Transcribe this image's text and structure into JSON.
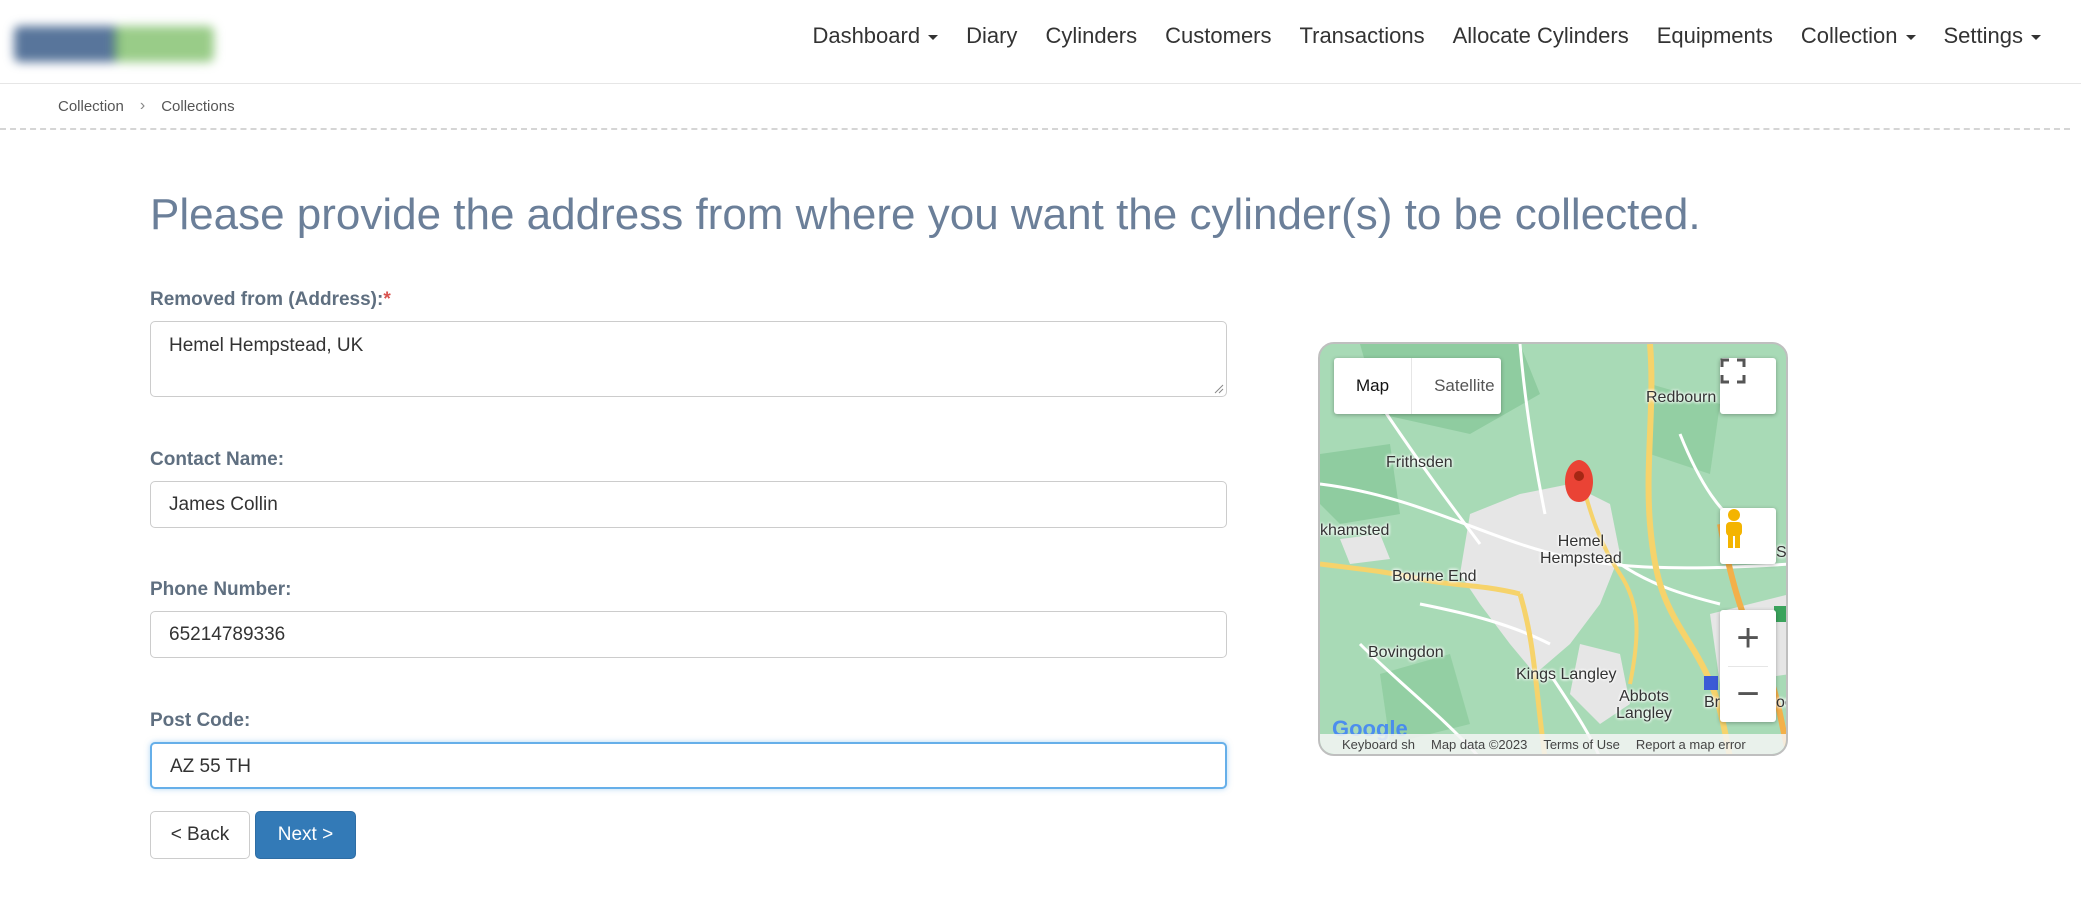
{
  "navbar": {
    "items": [
      {
        "label": "Dashboard",
        "dropdown": true
      },
      {
        "label": "Diary",
        "dropdown": false
      },
      {
        "label": "Cylinders",
        "dropdown": false
      },
      {
        "label": "Customers",
        "dropdown": false
      },
      {
        "label": "Transactions",
        "dropdown": false
      },
      {
        "label": "Allocate Cylinders",
        "dropdown": false
      },
      {
        "label": "Equipments",
        "dropdown": false
      },
      {
        "label": "Collection",
        "dropdown": true
      },
      {
        "label": "Settings",
        "dropdown": true
      }
    ]
  },
  "breadcrumb": {
    "items": [
      "Collection",
      "Collections"
    ],
    "separator": "›"
  },
  "main": {
    "title": "Please provide the address from where you want the cylinder(s) to be collected."
  },
  "form": {
    "address": {
      "label": "Removed from (Address):",
      "required_mark": "*",
      "value": "Hemel Hempstead, UK"
    },
    "contact": {
      "label": "Contact Name:",
      "value": "James Collin"
    },
    "phone": {
      "label": "Phone Number:",
      "value": "65214789336"
    },
    "postcode": {
      "label": "Post Code:",
      "value": "AZ 55 TH"
    },
    "back_label": "< Back",
    "next_label": "Next >"
  },
  "map": {
    "type_map": "Map",
    "type_satellite": "Satellite",
    "zoom_in": "+",
    "zoom_out": "−",
    "labels": {
      "redbourn": "Redbourn",
      "frithsden": "Frithsden",
      "khamsted": "khamsted",
      "hemel": "Hemel",
      "hempstead": "Hempstead",
      "bourne_end": "Bourne End",
      "st": "St",
      "bovingdon": "Bovingdon",
      "kings_langley": "Kings Langley",
      "abbots": "Abbots",
      "langley": "Langley",
      "br": "Br",
      "oc": "oc"
    },
    "footer": {
      "keyboard": "Keyboard sh",
      "data": "Map data ©2023",
      "terms": "Terms of Use",
      "report": "Report a map error"
    },
    "google": "Google",
    "colors": {
      "land": "#a7d9b5",
      "urban": "#e8e8e8",
      "road_major": "#f6d36b",
      "road_minor": "#ffffff",
      "pin": "#ea4335"
    }
  }
}
